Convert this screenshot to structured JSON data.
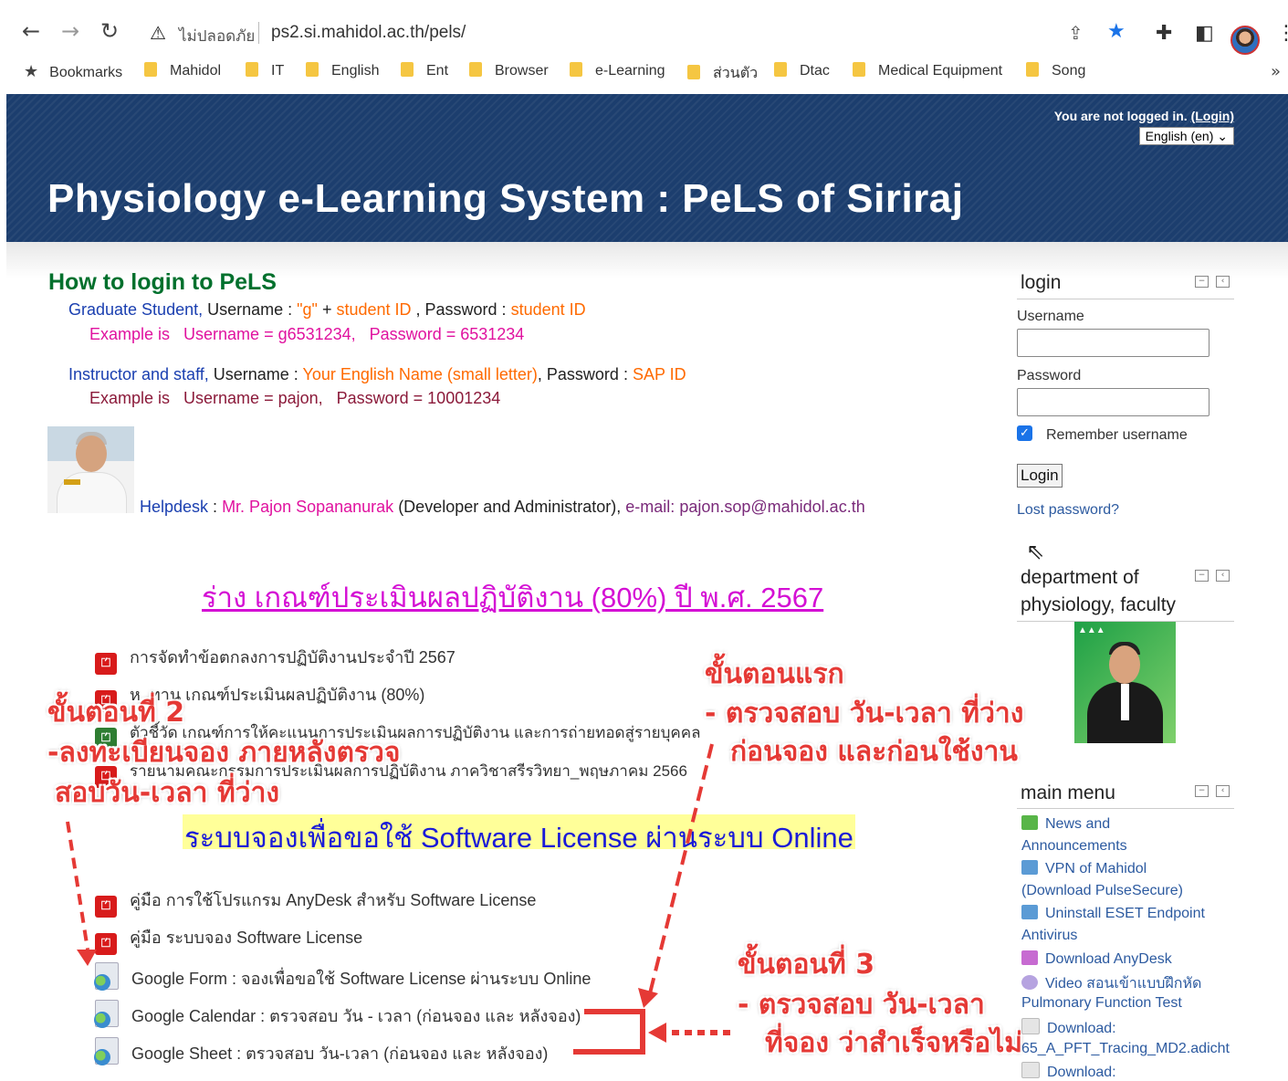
{
  "browser": {
    "security_status": "ไม่ปลอดภัย",
    "url": "ps2.si.mahidol.ac.th/pels/",
    "bookmarks": [
      {
        "label": "Bookmarks",
        "icon": "star-icon"
      },
      {
        "label": "Mahidol"
      },
      {
        "label": "IT"
      },
      {
        "label": "English"
      },
      {
        "label": "Ent"
      },
      {
        "label": "Browser"
      },
      {
        "label": "e-Learning"
      },
      {
        "label": "ส่วนตัว"
      },
      {
        "label": "Dtac"
      },
      {
        "label": "Medical Equipment"
      },
      {
        "label": "Song"
      }
    ],
    "more": "»"
  },
  "header": {
    "not_logged_in": "You are not logged in.",
    "login_link": "(Login)",
    "language": "English (en)",
    "title": "Physiology e-Learning System : PeLS of Siriraj"
  },
  "howto": {
    "title": "How to login to PeLS",
    "grad_role": "Graduate Student,",
    "grad_user_label": " Username : ",
    "grad_user_value": "\"g\"",
    "grad_plus": " + ",
    "grad_user_id": "student ID",
    "grad_pass_label": " , Password : ",
    "grad_pass_value": "student ID",
    "grad_example": "Example is   Username = g6531234,   Password = 6531234",
    "staff_role": "Instructor and staff,",
    "staff_user_label": " Username : ",
    "staff_user_value": "Your English Name (small letter)",
    "staff_pass_label": ", Password : ",
    "staff_pass_value": "SAP ID",
    "staff_example": "Example is   Username = pajon,   Password = 10001234",
    "helpdesk_label": "Helpdesk",
    "helpdesk_colon": " : ",
    "helpdesk_name": "Mr. Pajon Sopananurak",
    "helpdesk_role": " (Developer and Administrator), ",
    "helpdesk_email_label": "e-mail: ",
    "helpdesk_email": "pajon.sop@mahidol.ac.th"
  },
  "content": {
    "criteria_link": "ร่าง เกณฑ์ประเมินผลปฏิบัติงาน (80%) ปี พ.ศ. 2567",
    "files_top": [
      "การจัดทำข้อตกลงการปฏิบัติงานประจำปี 2567",
      "ห. ทาน เกณฑ์ประเมินผลปฏิบัติงาน (80%)",
      "ตัวชี้วัด เกณฑ์การให้คะแนนการประเมินผลการปฏิบัติงาน และการถ่ายทอดสู่รายบุคคล",
      "รายนามคณะกรรมการประเมินผลการปฏิบัติงาน ภาควิชาสรีรวิทยา_พฤษภาคม 2566"
    ],
    "software_heading": "ระบบจองเพื่อขอใช้ Software License ผ่านระบบ Online",
    "files_bottom": [
      {
        "label": "คู่มือ การใช้โปรแกรม AnyDesk สำหรับ Software License",
        "type": "pdf"
      },
      {
        "label": "คู่มือ ระบบจอง Software License",
        "type": "pdf"
      },
      {
        "label": "Google Form : จองเพื่อขอใช้ Software License ผ่านระบบ Online",
        "type": "web"
      },
      {
        "label": "Google Calendar : ตรวจสอบ วัน - เวลา (ก่อนจอง และ หลังจอง)",
        "type": "web"
      },
      {
        "label": "Google Sheet : ตรวจสอบ วัน-เวลา (ก่อนจอง และ หลังจอง)",
        "type": "web"
      }
    ]
  },
  "annotations": {
    "step1_title": "ขั้นตอนแรก",
    "step1_line1": "- ตรวจสอบ วัน-เวลา ที่ว่าง",
    "step1_line2": "ก่อนจอง และก่อนใช้งาน",
    "step2_title": "ขั้นตอนที่ 2",
    "step2_line1": "-ลงทะเบียนจอง ภายหลังตรวจ",
    "step2_line2": "สอบวัน-เวลา ที่ว่าง",
    "step3_title": "ขั้นตอนที่ 3",
    "step3_line1": "- ตรวจสอบ วัน-เวลา",
    "step3_line2": "ที่จอง ว่าสำเร็จหรือไม่",
    "accent_color": "#e53935"
  },
  "sidebar": {
    "login": {
      "title": "login",
      "username_label": "Username",
      "password_label": "Password",
      "remember_label": "Remember username",
      "remember_checked": true,
      "login_button": "Login",
      "lost_password": "Lost password?"
    },
    "department": {
      "title_line1": "department of",
      "title_line2": "physiology, faculty"
    },
    "main_menu": {
      "title": "main menu",
      "items": [
        {
          "line1": "News and",
          "line2": "Announcements"
        },
        {
          "line1": "VPN of Mahidol",
          "line2": "(Download PulseSecure)"
        },
        {
          "line1": "Uninstall ESET Endpoint",
          "line2": "Antivirus"
        },
        {
          "line1": "Download AnyDesk",
          "line2": ""
        },
        {
          "line1": "Video สอนเข้าแบบฝึกหัด",
          "line2": "Pulmonary Function Test"
        },
        {
          "line1": "Download:",
          "line2": "65_A_PFT_Tracing_MD2.adicht"
        },
        {
          "line1": "Download:",
          "line2": ""
        }
      ]
    }
  },
  "colors": {
    "header_bg": "#1c3e6e",
    "howto_green": "#00702d",
    "link_magenta": "#d40fd4",
    "highlight_yellow": "#ffff99"
  }
}
